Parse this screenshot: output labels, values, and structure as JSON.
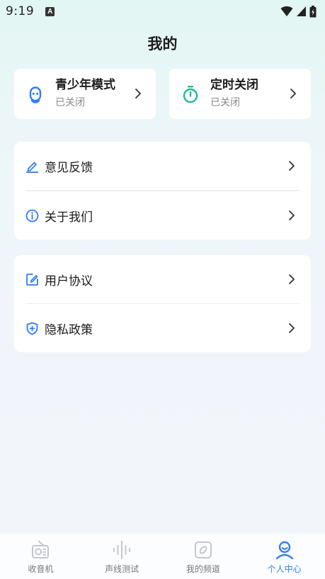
{
  "status_bar": {
    "time": "9:19",
    "notification_badge": "A"
  },
  "page_title": "我的",
  "quick_cards": [
    {
      "title": "青少年模式",
      "subtitle": "已关闭",
      "icon": "robot-face-icon",
      "icon_color": "#2f7cf5"
    },
    {
      "title": "定时关闭",
      "subtitle": "已关闭",
      "icon": "stopwatch-icon",
      "icon_color": "#1dbc95"
    }
  ],
  "group1": [
    {
      "label": "意见反馈",
      "icon": "pen-icon"
    },
    {
      "label": "关于我们",
      "icon": "info-icon"
    }
  ],
  "group2": [
    {
      "label": "用户协议",
      "icon": "edit-document-icon"
    },
    {
      "label": "隐私政策",
      "icon": "shield-plus-icon"
    }
  ],
  "tabbar": [
    {
      "label": "收音机",
      "icon": "radio-icon",
      "active": false
    },
    {
      "label": "声线测试",
      "icon": "soundwave-icon",
      "active": false
    },
    {
      "label": "我的频道",
      "icon": "channel-icon",
      "active": false
    },
    {
      "label": "个人中心",
      "icon": "person-icon",
      "active": true
    }
  ],
  "colors": {
    "accent": "#2f7cf5",
    "teal": "#1dbc95",
    "inactive": "#c3c6cc"
  }
}
